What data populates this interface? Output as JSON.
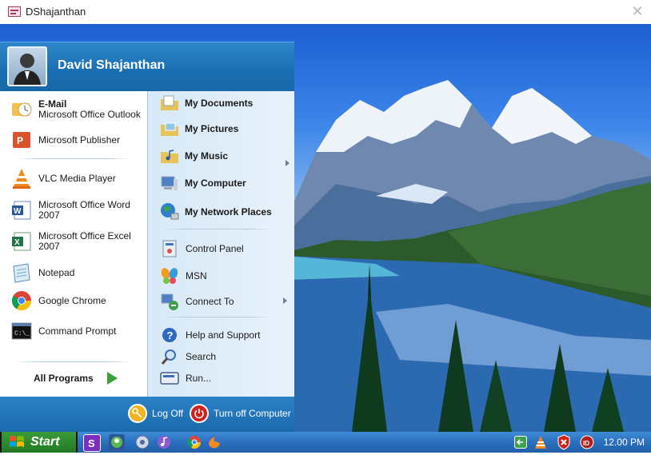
{
  "window": {
    "title": "DShajanthan",
    "close_glyph": "✕"
  },
  "user": {
    "name": "David Shajanthan"
  },
  "left_items": [
    {
      "id": "email",
      "title": "E-Mail",
      "subtitle": "Microsoft Office Outlook",
      "icon": "outlook-icon"
    },
    {
      "id": "publisher",
      "label": "Microsoft Publisher",
      "icon": "publisher-icon"
    },
    {
      "id": "vlc",
      "label": "VLC Media Player",
      "icon": "vlc-icon"
    },
    {
      "id": "word",
      "label_1": "Microsoft Office Word",
      "label_2": "2007",
      "icon": "word-icon"
    },
    {
      "id": "excel",
      "label_1": "Microsoft Office Excel",
      "label_2": "2007",
      "icon": "excel-icon"
    },
    {
      "id": "notepad",
      "label": "Notepad",
      "icon": "notepad-icon"
    },
    {
      "id": "chrome",
      "label": "Google Chrome",
      "icon": "chrome-icon"
    },
    {
      "id": "cmd",
      "label": "Command Prompt",
      "icon": "command-prompt-icon"
    }
  ],
  "all_programs": "All Programs",
  "right_items": {
    "my_documents": "My Documents",
    "my_pictures": "My Pictures",
    "my_music": "My Music",
    "my_computer": "My Computer",
    "my_network_places": "My Network Places",
    "control_panel": "Control Panel",
    "msn": "MSN",
    "connect_to": "Connect To",
    "help_support": "Help and Support",
    "search": "Search",
    "run": "Run..."
  },
  "footer": {
    "log_off": "Log Off",
    "turn_off": "Turn off Computer"
  },
  "taskbar": {
    "start_label": "Start",
    "time": "12.00 PM"
  },
  "colors": {
    "menu_blue": "#1a6fb1",
    "taskbar_blue": "#2a6fbd",
    "start_green": "#2f8f2f"
  }
}
